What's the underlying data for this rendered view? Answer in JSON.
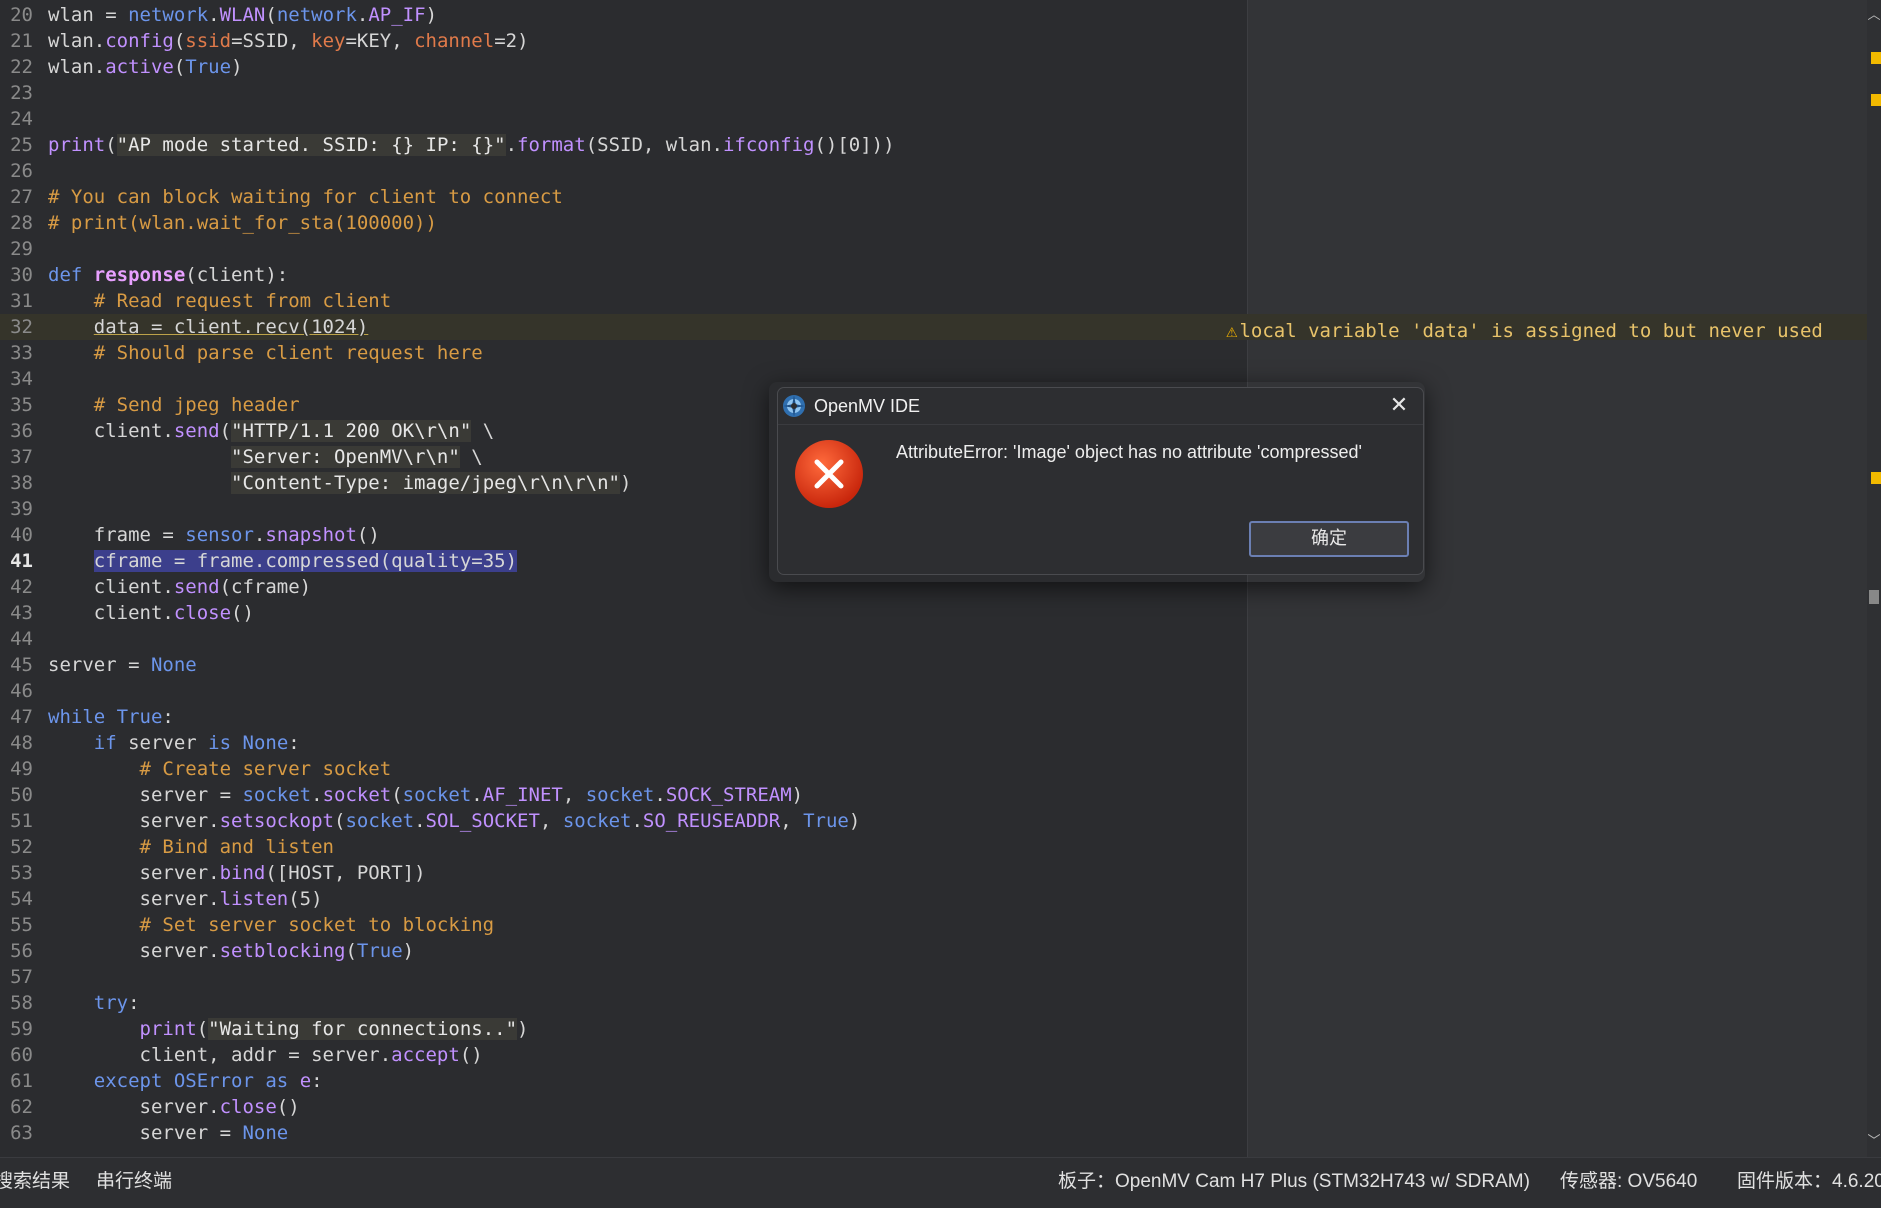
{
  "editor": {
    "lines": [
      {
        "n": "20",
        "t": [
          [
            "plain",
            "wlan = "
          ],
          [
            "attr",
            "network"
          ],
          [
            "plain",
            "."
          ],
          [
            "fn",
            "WLAN"
          ],
          [
            "plain",
            "("
          ],
          [
            "attr",
            "network"
          ],
          [
            "plain",
            "."
          ],
          [
            "fn",
            "AP_IF"
          ],
          [
            "plain",
            ")"
          ]
        ]
      },
      {
        "n": "21",
        "t": [
          [
            "plain",
            "wlan."
          ],
          [
            "fn",
            "config"
          ],
          [
            "plain",
            "("
          ],
          [
            "kwarg",
            "ssid"
          ],
          [
            "plain",
            "=SSID, "
          ],
          [
            "kwarg",
            "key"
          ],
          [
            "plain",
            "=KEY, "
          ],
          [
            "kwarg",
            "channel"
          ],
          [
            "plain",
            "=2)"
          ]
        ]
      },
      {
        "n": "22",
        "t": [
          [
            "plain",
            "wlan."
          ],
          [
            "fn",
            "active"
          ],
          [
            "plain",
            "("
          ],
          [
            "kw",
            "True"
          ],
          [
            "plain",
            ")"
          ]
        ]
      },
      {
        "n": "23",
        "t": []
      },
      {
        "n": "24",
        "t": []
      },
      {
        "n": "25",
        "t": [
          [
            "fn",
            "print"
          ],
          [
            "plain",
            "("
          ],
          [
            "str",
            "\"AP mode started. SSID: {} IP: {}\""
          ],
          [
            "plain",
            "."
          ],
          [
            "fn",
            "format"
          ],
          [
            "plain",
            "(SSID, wlan."
          ],
          [
            "fn",
            "ifconfig"
          ],
          [
            "plain",
            "()[0]))"
          ]
        ]
      },
      {
        "n": "26",
        "t": []
      },
      {
        "n": "27",
        "t": [
          [
            "cm",
            "# You can block waiting for client to connect"
          ]
        ]
      },
      {
        "n": "28",
        "t": [
          [
            "cm",
            "# print(wlan.wait_for_sta(100000))"
          ]
        ]
      },
      {
        "n": "29",
        "t": []
      },
      {
        "n": "30",
        "t": [
          [
            "kw",
            "def "
          ],
          [
            "def",
            "response"
          ],
          [
            "plain",
            "(client):"
          ]
        ]
      },
      {
        "n": "31",
        "t": [
          [
            "plain",
            "    "
          ],
          [
            "cm",
            "# Read request from client"
          ]
        ]
      },
      {
        "n": "32",
        "t": [
          [
            "plain",
            "    "
          ],
          [
            "ul",
            "data = client.recv(1024)"
          ]
        ],
        "warn": true
      },
      {
        "n": "33",
        "t": [
          [
            "plain",
            "    "
          ],
          [
            "cm",
            "# Should parse client request here"
          ]
        ]
      },
      {
        "n": "34",
        "t": []
      },
      {
        "n": "35",
        "t": [
          [
            "plain",
            "    "
          ],
          [
            "cm",
            "# Send jpeg header"
          ]
        ]
      },
      {
        "n": "36",
        "t": [
          [
            "plain",
            "    client."
          ],
          [
            "fn",
            "send"
          ],
          [
            "plain",
            "("
          ],
          [
            "str",
            "\"HTTP/1.1 200 OK\\r\\n\""
          ],
          [
            "plain",
            " \\"
          ]
        ]
      },
      {
        "n": "37",
        "t": [
          [
            "plain",
            "                "
          ],
          [
            "str",
            "\"Server: OpenMV\\r\\n\""
          ],
          [
            "plain",
            " \\"
          ]
        ]
      },
      {
        "n": "38",
        "t": [
          [
            "plain",
            "                "
          ],
          [
            "str",
            "\"Content-Type: image/jpeg\\r\\n\\r\\n\""
          ],
          [
            "plain",
            ")"
          ]
        ]
      },
      {
        "n": "39",
        "t": []
      },
      {
        "n": "40",
        "t": [
          [
            "plain",
            "    frame = "
          ],
          [
            "attr",
            "sensor"
          ],
          [
            "plain",
            "."
          ],
          [
            "fn",
            "snapshot"
          ],
          [
            "plain",
            "()"
          ]
        ]
      },
      {
        "n": "41",
        "t": [
          [
            "plain",
            "    "
          ],
          [
            "sel",
            "cframe = frame.compressed(quality=35)"
          ]
        ],
        "cur": true
      },
      {
        "n": "42",
        "t": [
          [
            "plain",
            "    client."
          ],
          [
            "fn",
            "send"
          ],
          [
            "plain",
            "(cframe)"
          ]
        ]
      },
      {
        "n": "43",
        "t": [
          [
            "plain",
            "    client."
          ],
          [
            "fn",
            "close"
          ],
          [
            "plain",
            "()"
          ]
        ]
      },
      {
        "n": "44",
        "t": []
      },
      {
        "n": "45",
        "t": [
          [
            "plain",
            "server = "
          ],
          [
            "kw",
            "None"
          ]
        ]
      },
      {
        "n": "46",
        "t": []
      },
      {
        "n": "47",
        "t": [
          [
            "kw",
            "while "
          ],
          [
            "kw",
            "True"
          ],
          [
            "plain",
            ":"
          ]
        ]
      },
      {
        "n": "48",
        "t": [
          [
            "plain",
            "    "
          ],
          [
            "kw",
            "if"
          ],
          [
            "plain",
            " server "
          ],
          [
            "kw",
            "is"
          ],
          [
            "plain",
            " "
          ],
          [
            "kw",
            "None"
          ],
          [
            "plain",
            ":"
          ]
        ]
      },
      {
        "n": "49",
        "t": [
          [
            "plain",
            "        "
          ],
          [
            "cm",
            "# Create server socket"
          ]
        ]
      },
      {
        "n": "50",
        "t": [
          [
            "plain",
            "        server = "
          ],
          [
            "attr",
            "socket"
          ],
          [
            "plain",
            "."
          ],
          [
            "fn",
            "socket"
          ],
          [
            "plain",
            "("
          ],
          [
            "attr",
            "socket"
          ],
          [
            "plain",
            "."
          ],
          [
            "fn",
            "AF_INET"
          ],
          [
            "plain",
            ", "
          ],
          [
            "attr",
            "socket"
          ],
          [
            "plain",
            "."
          ],
          [
            "fn",
            "SOCK_STREAM"
          ],
          [
            "plain",
            ")"
          ]
        ]
      },
      {
        "n": "51",
        "t": [
          [
            "plain",
            "        server."
          ],
          [
            "fn",
            "setsockopt"
          ],
          [
            "plain",
            "("
          ],
          [
            "attr",
            "socket"
          ],
          [
            "plain",
            "."
          ],
          [
            "fn",
            "SOL_SOCKET"
          ],
          [
            "plain",
            ", "
          ],
          [
            "attr",
            "socket"
          ],
          [
            "plain",
            "."
          ],
          [
            "fn",
            "SO_REUSEADDR"
          ],
          [
            "plain",
            ", "
          ],
          [
            "kw",
            "True"
          ],
          [
            "plain",
            ")"
          ]
        ]
      },
      {
        "n": "52",
        "t": [
          [
            "plain",
            "        "
          ],
          [
            "cm",
            "# Bind and listen"
          ]
        ]
      },
      {
        "n": "53",
        "t": [
          [
            "plain",
            "        server."
          ],
          [
            "fn",
            "bind"
          ],
          [
            "plain",
            "([HOST, PORT])"
          ]
        ]
      },
      {
        "n": "54",
        "t": [
          [
            "plain",
            "        server."
          ],
          [
            "fn",
            "listen"
          ],
          [
            "plain",
            "(5)"
          ]
        ]
      },
      {
        "n": "55",
        "t": [
          [
            "plain",
            "        "
          ],
          [
            "cm",
            "# Set server socket to blocking"
          ]
        ]
      },
      {
        "n": "56",
        "t": [
          [
            "plain",
            "        server."
          ],
          [
            "fn",
            "setblocking"
          ],
          [
            "plain",
            "("
          ],
          [
            "kw",
            "True"
          ],
          [
            "plain",
            ")"
          ]
        ]
      },
      {
        "n": "57",
        "t": []
      },
      {
        "n": "58",
        "t": [
          [
            "plain",
            "    "
          ],
          [
            "kw",
            "try"
          ],
          [
            "plain",
            ":"
          ]
        ]
      },
      {
        "n": "59",
        "t": [
          [
            "plain",
            "        "
          ],
          [
            "fn",
            "print"
          ],
          [
            "plain",
            "("
          ],
          [
            "str",
            "\"Waiting for connections..\""
          ],
          [
            "plain",
            ")"
          ]
        ]
      },
      {
        "n": "60",
        "t": [
          [
            "plain",
            "        client, addr = server."
          ],
          [
            "fn",
            "accept"
          ],
          [
            "plain",
            "()"
          ]
        ]
      },
      {
        "n": "61",
        "t": [
          [
            "plain",
            "    "
          ],
          [
            "kw",
            "except "
          ],
          [
            "attr",
            "OSError"
          ],
          [
            "kw",
            " as "
          ],
          [
            "fn",
            "e"
          ],
          [
            "plain",
            ":"
          ]
        ]
      },
      {
        "n": "62",
        "t": [
          [
            "plain",
            "        server."
          ],
          [
            "fn",
            "close"
          ],
          [
            "plain",
            "()"
          ]
        ]
      },
      {
        "n": "63",
        "t": [
          [
            "plain",
            "        server = "
          ],
          [
            "kw",
            "None"
          ]
        ]
      }
    ],
    "warning": "local variable 'data' is assigned to but never used"
  },
  "dialog": {
    "title": "OpenMV IDE",
    "message": "AttributeError: 'Image' object has no attribute 'compressed'",
    "ok_label": "确定"
  },
  "statusbar": {
    "search_results": "搜索结果",
    "serial_terminal": "串行终端",
    "board": "板子：OpenMV Cam H7 Plus (STM32H743 w/ SDRAM)",
    "sensor": "传感器: OV5640",
    "firmware": "固件版本：4.6.20"
  },
  "colors": {
    "error_red": "#e23d1d",
    "warning_yellow": "#f2b900",
    "selection": "#3c3f8c"
  }
}
